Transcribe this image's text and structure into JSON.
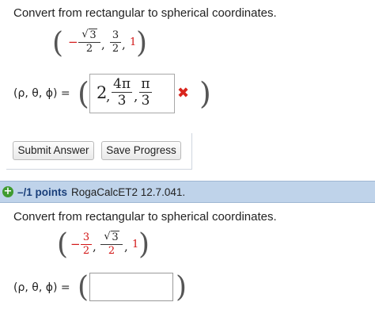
{
  "question1": {
    "prompt": "Convert from rectangular to spherical coordinates.",
    "point": {
      "open_paren": "(",
      "close_paren": ")",
      "x_sign": "−",
      "x_num_radicand": "3",
      "x_den": "2",
      "sep1": ",",
      "y_num": "3",
      "y_den": "2",
      "sep2": ",",
      "z": "1"
    },
    "answer_label": "(ρ, θ, ϕ) =",
    "answer": {
      "open_paren": "(",
      "close_paren": ")",
      "rho": "2",
      "sep1": ",",
      "theta_num": "4π",
      "theta_den": "3",
      "sep2": ",",
      "phi_num": "π",
      "phi_den": "3"
    },
    "incorrect_icon": "✖",
    "submit_label": "Submit Answer",
    "save_label": "Save Progress"
  },
  "question2": {
    "header": {
      "expand_icon": "+",
      "points": "–/1 points",
      "source": "RogaCalcET2 12.7.041."
    },
    "prompt": "Convert from rectangular to spherical coordinates.",
    "point": {
      "open_paren": "(",
      "close_paren": ")",
      "x_sign": "−",
      "x_num": "3",
      "x_den": "2",
      "sep1": ",",
      "y_num_radicand": "3",
      "y_den": "2",
      "sep2": ",",
      "z": "1"
    },
    "answer_label": "(ρ, θ, ϕ) =",
    "answer": {
      "open_paren": "(",
      "close_paren": ")",
      "value": ""
    }
  },
  "colors": {
    "header_bg": "#bfd3ea",
    "points_text": "#1a3f7a",
    "incorrect_red": "#d9251d",
    "data_red": "#d21414",
    "expand_green": "#3f9b2f"
  }
}
